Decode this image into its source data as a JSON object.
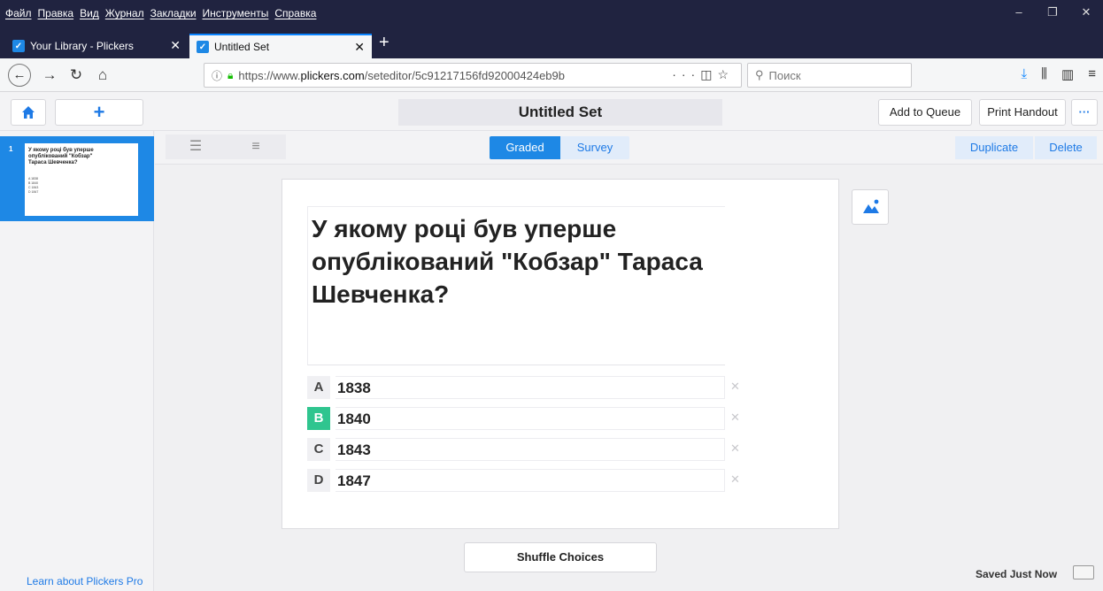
{
  "browser": {
    "menu": [
      "Файл",
      "Правка",
      "Вид",
      "Журнал",
      "Закладки",
      "Инструменты",
      "Справка"
    ],
    "tabs": [
      {
        "label": "Your Library - Plickers"
      },
      {
        "label": "Untitled Set"
      }
    ],
    "url_prefix": "https://www.",
    "url_domain": "plickers.com",
    "url_path": "/seteditor/5c91217156fd92000424eb9b",
    "search_placeholder": "Поиск",
    "accent": "#0a84ff"
  },
  "app": {
    "title": "Untitled Set",
    "actions": {
      "add_to_queue": "Add to Queue",
      "print_handout": "Print Handout",
      "more": "···"
    },
    "toolbar": {
      "graded": "Graded",
      "survey": "Survey",
      "duplicate": "Duplicate",
      "delete": "Delete"
    },
    "sidebar": {
      "slide_number": "1",
      "thumb_question": "У якому році був уперше опублікований \"Кобзар\" Тараса Шевченка?",
      "thumb_choices": [
        "A 1838",
        "B 1840",
        "C 1843",
        "D 1847"
      ],
      "pro_link": "Learn about Plickers Pro"
    },
    "question": "У якому році був уперше опублікований \"Кобзар\" Тараса Шевченка?",
    "choices": [
      {
        "letter": "A",
        "value": "1838",
        "correct": false
      },
      {
        "letter": "B",
        "value": "1840",
        "correct": true
      },
      {
        "letter": "C",
        "value": "1843",
        "correct": false
      },
      {
        "letter": "D",
        "value": "1847",
        "correct": false
      }
    ],
    "shuffle": "Shuffle Choices",
    "status": "Saved Just Now",
    "colors": {
      "brand": "#1e88e5",
      "correct": "#2fc58f"
    }
  }
}
